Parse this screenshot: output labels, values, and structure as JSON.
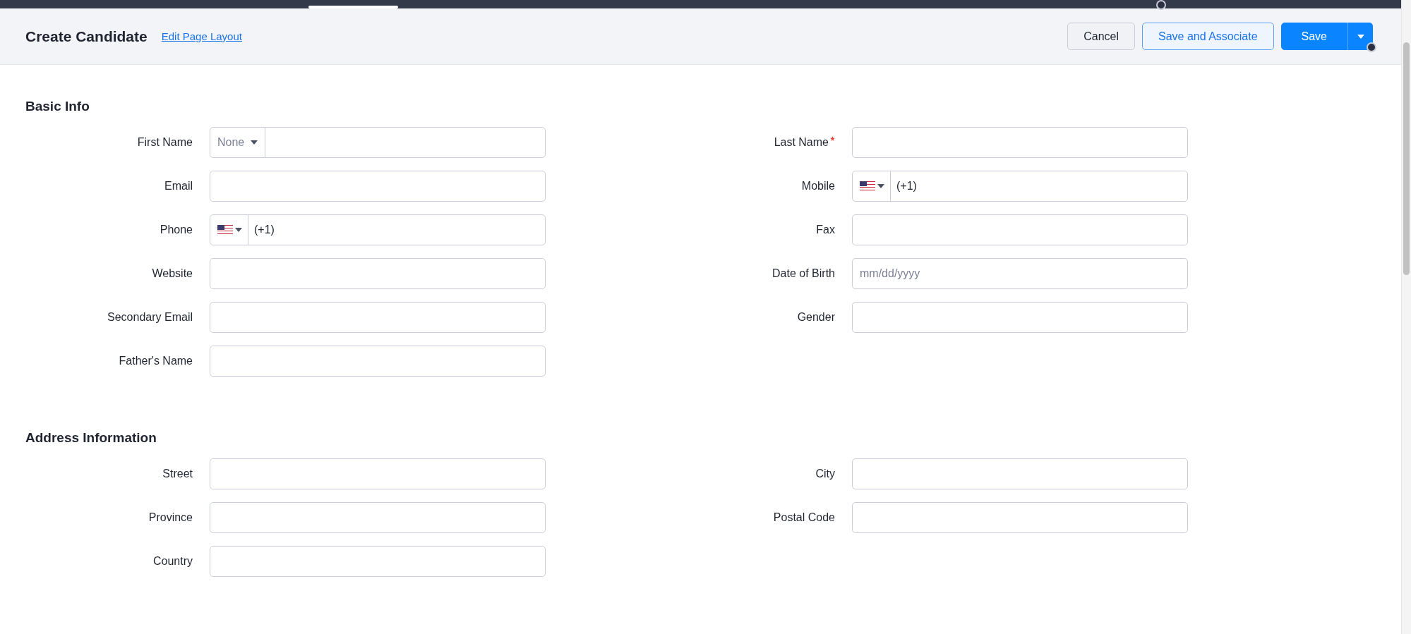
{
  "header": {
    "title": "Create Candidate",
    "link": "Edit Page Layout",
    "buttons": [
      {
        "label": "Cancel",
        "kind": "secondary"
      },
      {
        "label": "Save and Associate",
        "kind": "outline"
      },
      {
        "label": "Save",
        "kind": "split"
      }
    ]
  },
  "sections": [
    {
      "title": "Basic Info",
      "left": [
        {
          "label": "First Name",
          "kind": "salutation",
          "option": "None",
          "required": false
        },
        {
          "label": "Email",
          "kind": "text",
          "required": false
        },
        {
          "label": "Phone",
          "kind": "phone",
          "value": "(+1)",
          "required": false
        },
        {
          "label": "Website",
          "kind": "text",
          "required": false
        },
        {
          "label": "Secondary Email",
          "kind": "text",
          "required": false
        },
        {
          "label": "Father's Name",
          "kind": "text",
          "required": false
        }
      ],
      "right": [
        {
          "label": "Last Name",
          "kind": "text",
          "required": true
        },
        {
          "label": "Mobile",
          "kind": "phone",
          "value": "(+1)",
          "required": false
        },
        {
          "label": "Fax",
          "kind": "text",
          "required": false
        },
        {
          "label": "Date of Birth",
          "kind": "text",
          "placeholder": "mm/dd/yyyy",
          "required": false
        },
        {
          "label": "Gender",
          "kind": "text",
          "required": false
        }
      ]
    },
    {
      "title": "Address Information",
      "left": [
        {
          "label": "Street",
          "kind": "text",
          "required": false
        },
        {
          "label": "Province",
          "kind": "text",
          "required": false
        },
        {
          "label": "Country",
          "kind": "text",
          "required": false
        }
      ],
      "right": [
        {
          "label": "City",
          "kind": "text",
          "required": false
        },
        {
          "label": "Postal Code",
          "kind": "text",
          "required": false
        }
      ]
    }
  ]
}
